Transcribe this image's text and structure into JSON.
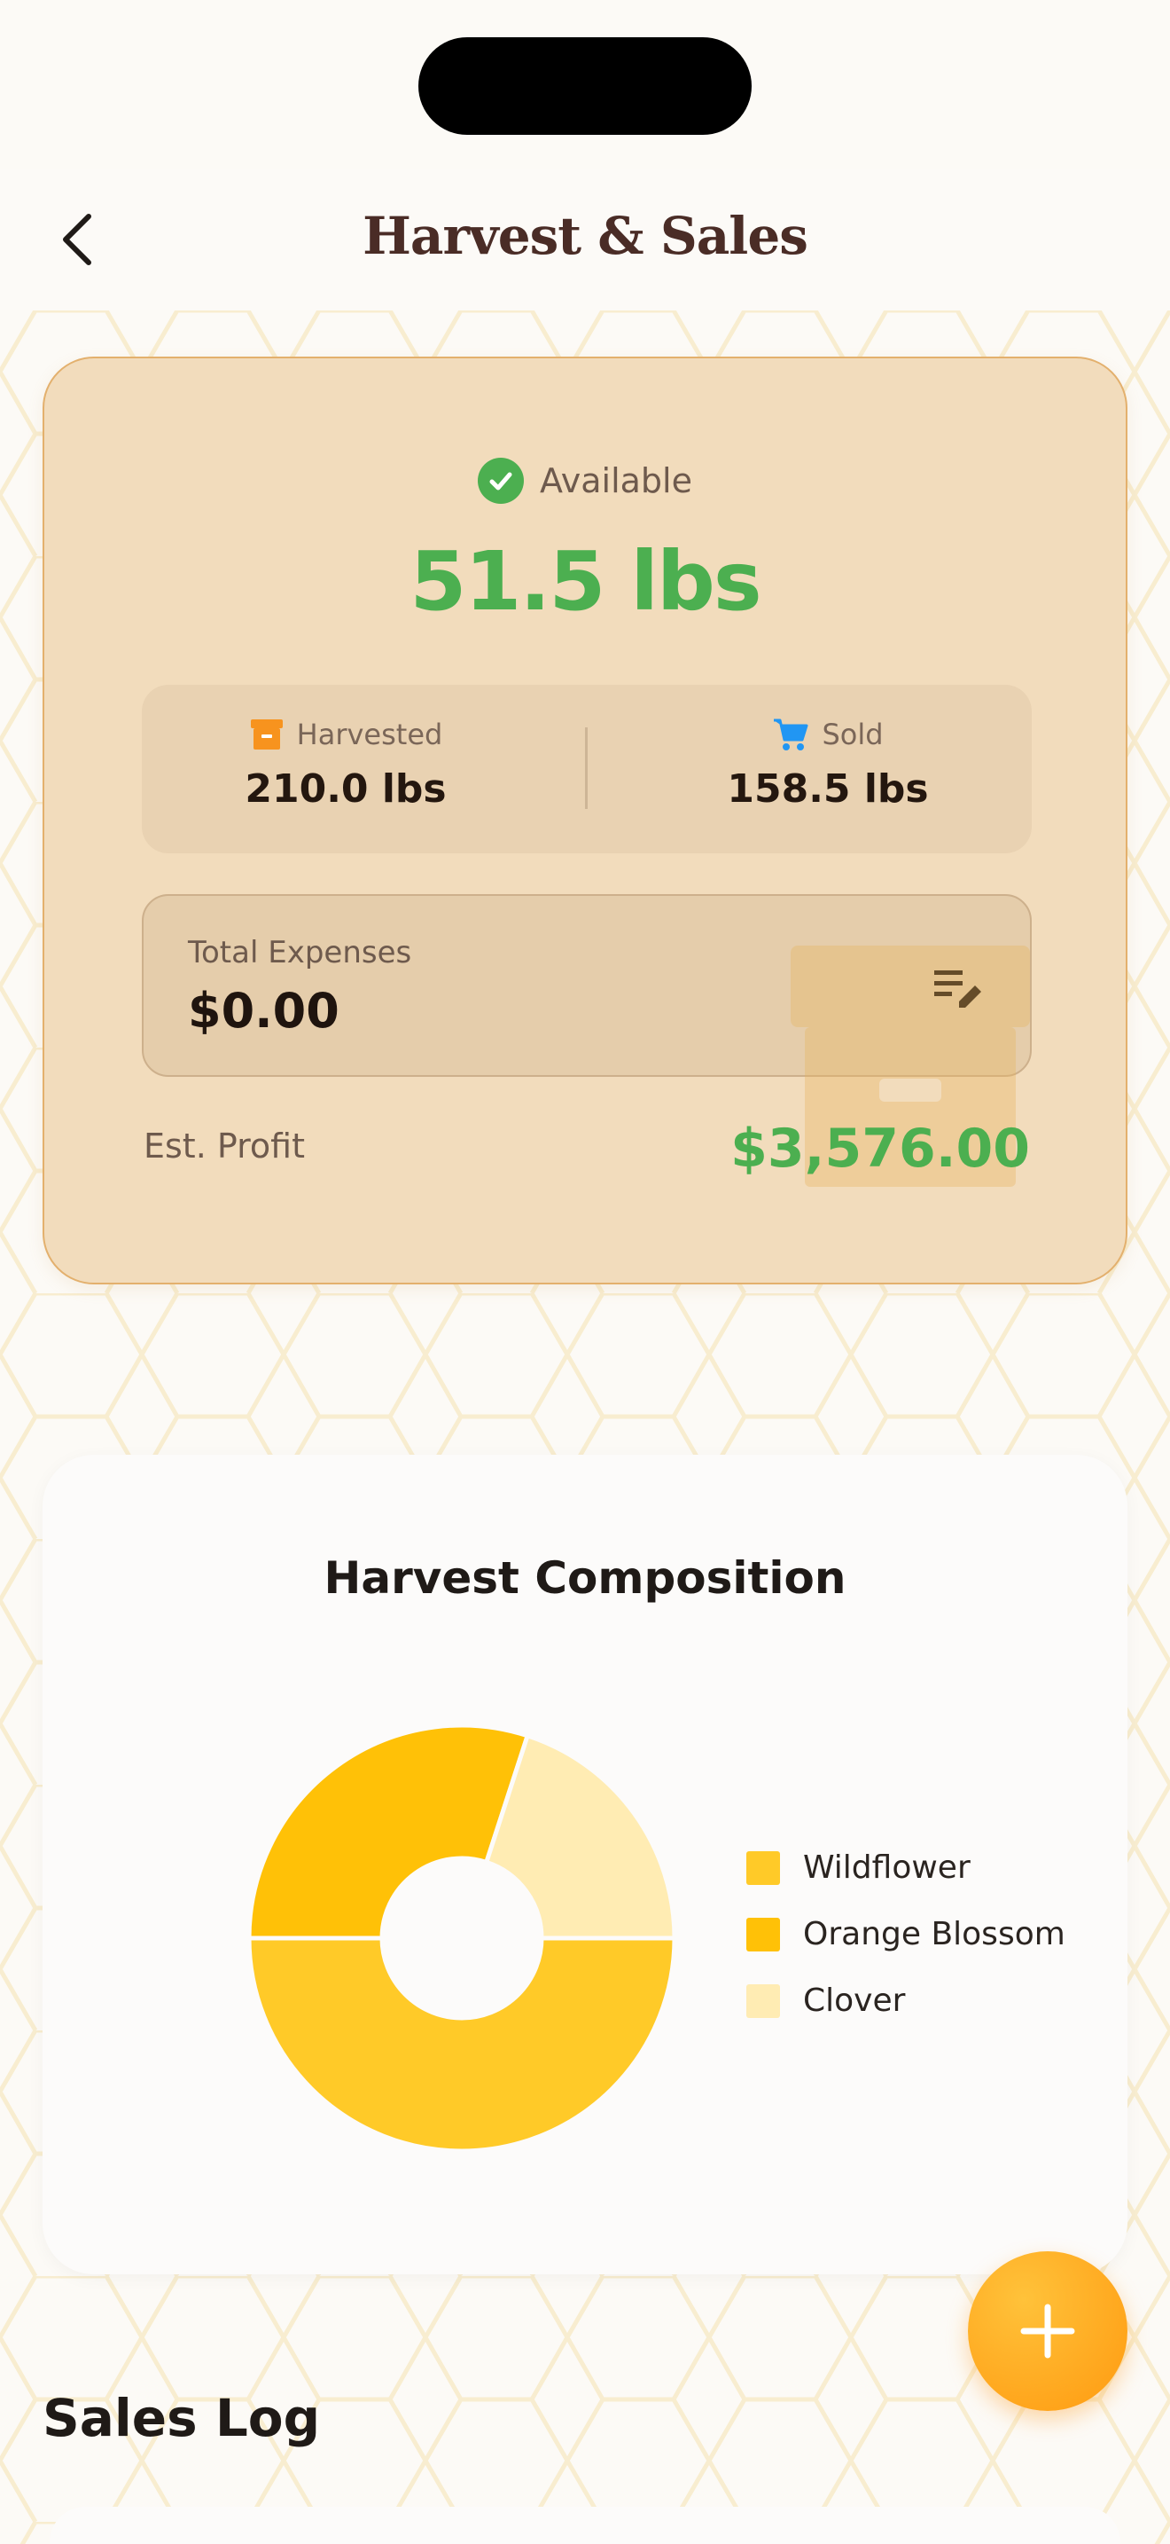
{
  "header": {
    "title": "Harvest & Sales",
    "back_icon": "chevron-left-icon"
  },
  "summary": {
    "available_label": "Available",
    "available_value": "51.5 lbs",
    "harvested_label": "Harvested",
    "harvested_value": "210.0 lbs",
    "sold_label": "Sold",
    "sold_value": "158.5 lbs",
    "expenses_label": "Total Expenses",
    "expenses_value": "$0.00",
    "profit_label": "Est. Profit",
    "profit_value": "$3,576.00",
    "colors": {
      "positive": "#4caf50",
      "harvest_icon": "#f7931e",
      "sold_icon": "#2196f3"
    }
  },
  "composition": {
    "title": "Harvest Composition"
  },
  "chart_data": {
    "type": "pie",
    "title": "Harvest Composition",
    "donut": true,
    "series": [
      {
        "name": "Wildflower",
        "value": 50,
        "color": "#ffca28"
      },
      {
        "name": "Orange Blossom",
        "value": 30,
        "color": "#ffc107"
      },
      {
        "name": "Clover",
        "value": 20,
        "color": "#ffecb3"
      }
    ],
    "legend_position": "right"
  },
  "fab": {
    "icon": "plus-icon"
  },
  "sales_log": {
    "title": "Sales Log"
  }
}
